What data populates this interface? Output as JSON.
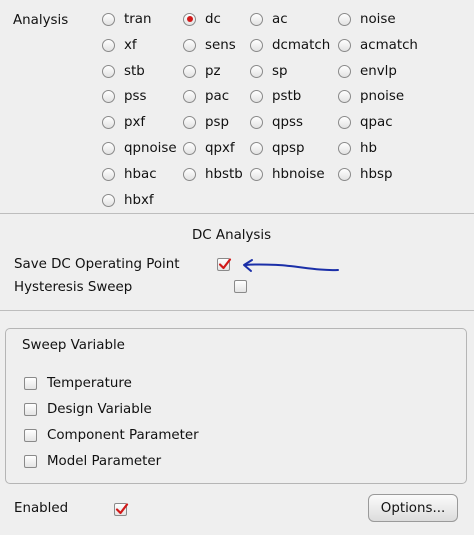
{
  "analysis": {
    "label": "Analysis",
    "options": [
      {
        "label": "tran",
        "selected": false
      },
      {
        "label": "dc",
        "selected": true
      },
      {
        "label": "ac",
        "selected": false
      },
      {
        "label": "noise",
        "selected": false
      },
      {
        "label": "xf",
        "selected": false
      },
      {
        "label": "sens",
        "selected": false
      },
      {
        "label": "dcmatch",
        "selected": false
      },
      {
        "label": "acmatch",
        "selected": false
      },
      {
        "label": "stb",
        "selected": false
      },
      {
        "label": "pz",
        "selected": false
      },
      {
        "label": "sp",
        "selected": false
      },
      {
        "label": "envlp",
        "selected": false
      },
      {
        "label": "pss",
        "selected": false
      },
      {
        "label": "pac",
        "selected": false
      },
      {
        "label": "pstb",
        "selected": false
      },
      {
        "label": "pnoise",
        "selected": false
      },
      {
        "label": "pxf",
        "selected": false
      },
      {
        "label": "psp",
        "selected": false
      },
      {
        "label": "qpss",
        "selected": false
      },
      {
        "label": "qpac",
        "selected": false
      },
      {
        "label": "qpnoise",
        "selected": false
      },
      {
        "label": "qpxf",
        "selected": false
      },
      {
        "label": "qpsp",
        "selected": false
      },
      {
        "label": "hb",
        "selected": false
      },
      {
        "label": "hbac",
        "selected": false
      },
      {
        "label": "hbstb",
        "selected": false
      },
      {
        "label": "hbnoise",
        "selected": false
      },
      {
        "label": "hbsp",
        "selected": false
      },
      {
        "label": "hbxf",
        "selected": false
      }
    ]
  },
  "dc_section": {
    "title": "DC Analysis",
    "save_op_label": "Save DC Operating Point",
    "save_op_checked": true,
    "hysteresis_label": "Hysteresis Sweep",
    "hysteresis_checked": false
  },
  "sweep": {
    "title": "Sweep Variable",
    "options": [
      {
        "label": "Temperature",
        "checked": false
      },
      {
        "label": "Design Variable",
        "checked": false
      },
      {
        "label": "Component Parameter",
        "checked": false
      },
      {
        "label": "Model Parameter",
        "checked": false
      }
    ]
  },
  "footer": {
    "enabled_label": "Enabled",
    "enabled_checked": true,
    "options_button": "Options..."
  },
  "colors": {
    "accent_red": "#d11a1a",
    "annotation_blue": "#1b2fa8"
  }
}
